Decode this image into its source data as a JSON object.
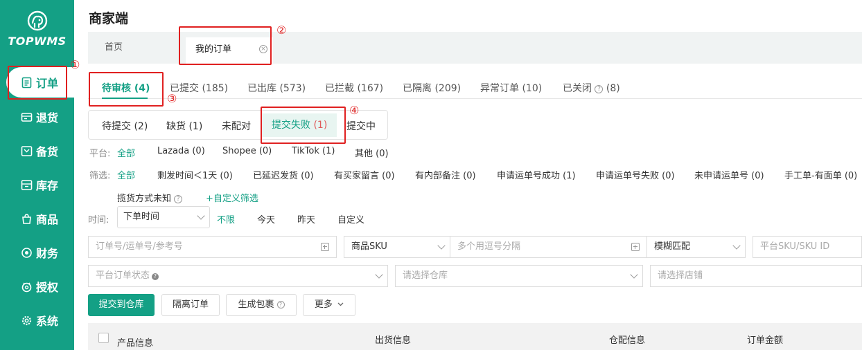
{
  "sidebar": {
    "logo_text": "TOPWMS",
    "items": [
      {
        "label": "订单",
        "icon": "order-icon"
      },
      {
        "label": "退货",
        "icon": "return-icon"
      },
      {
        "label": "备货",
        "icon": "stock-prep-icon"
      },
      {
        "label": "库存",
        "icon": "inventory-icon"
      },
      {
        "label": "商品",
        "icon": "product-icon"
      },
      {
        "label": "财务",
        "icon": "finance-icon"
      },
      {
        "label": "授权",
        "icon": "auth-icon"
      },
      {
        "label": "系统",
        "icon": "settings-icon"
      }
    ]
  },
  "header": {
    "app_title": "商家端",
    "tabs": [
      {
        "label": "首页"
      },
      {
        "label": "我的订单"
      }
    ]
  },
  "status_tabs": [
    {
      "label": "待审核 (4)"
    },
    {
      "label": "已提交 (185)"
    },
    {
      "label": "已出库 (573)"
    },
    {
      "label": "已拦截 (167)"
    },
    {
      "label": "已隔离 (209)"
    },
    {
      "label": "异常订单 (10)"
    },
    {
      "label": "已关闭"
    },
    {
      "label": "(8)"
    }
  ],
  "sub_tabs": [
    {
      "label": "待提交 (2)"
    },
    {
      "label": "缺货 (1)"
    },
    {
      "label": "未配对"
    },
    {
      "label": "提交失败",
      "count": "(1)"
    },
    {
      "label": "提交中"
    }
  ],
  "platform_filter": {
    "label": "平台:",
    "options": [
      "全部",
      "Lazada (0)",
      "Shopee (0)",
      "TikTok (1)",
      "其他 (0)"
    ]
  },
  "screen_filter": {
    "label": "筛选:",
    "options": [
      "全部",
      "剩发时间＜1天 (0)",
      "已延迟发货 (0)",
      "有买家留言 (0)",
      "有内部备注 (0)",
      "申请运单号成功 (1)",
      "申请运单号失败 (0)",
      "未申请运单号 (0)",
      "手工单-有面单 (0)"
    ],
    "row2_option": "揽货方式未知",
    "custom_label": "+自定义筛选"
  },
  "time_filter": {
    "label": "时间:",
    "select_value": "下单时间",
    "options": [
      "不限",
      "今天",
      "昨天",
      "自定义"
    ]
  },
  "search": {
    "order_placeholder": "订单号/运单号/参考号",
    "sku_type": "商品SKU",
    "sku_placeholder": "多个用逗号分隔",
    "match_mode": "模糊匹配",
    "platform_sku_placeholder": "平台SKU/SKU ID",
    "platform_status_placeholder": "平台订单状态",
    "warehouse_placeholder": "请选择仓库",
    "store_placeholder": "请选择店铺"
  },
  "actions": {
    "submit": "提交到仓库",
    "isolate": "隔离订单",
    "generate": "生成包裹",
    "more": "更多"
  },
  "table": {
    "columns": [
      "产品信息",
      "出货信息",
      "仓配信息",
      "订单金额"
    ]
  },
  "annotations": [
    "①",
    "②",
    "③",
    "④"
  ],
  "colors": {
    "brand": "#14a085",
    "annotation": "#e02020",
    "count_highlight": "#e05a5a"
  }
}
